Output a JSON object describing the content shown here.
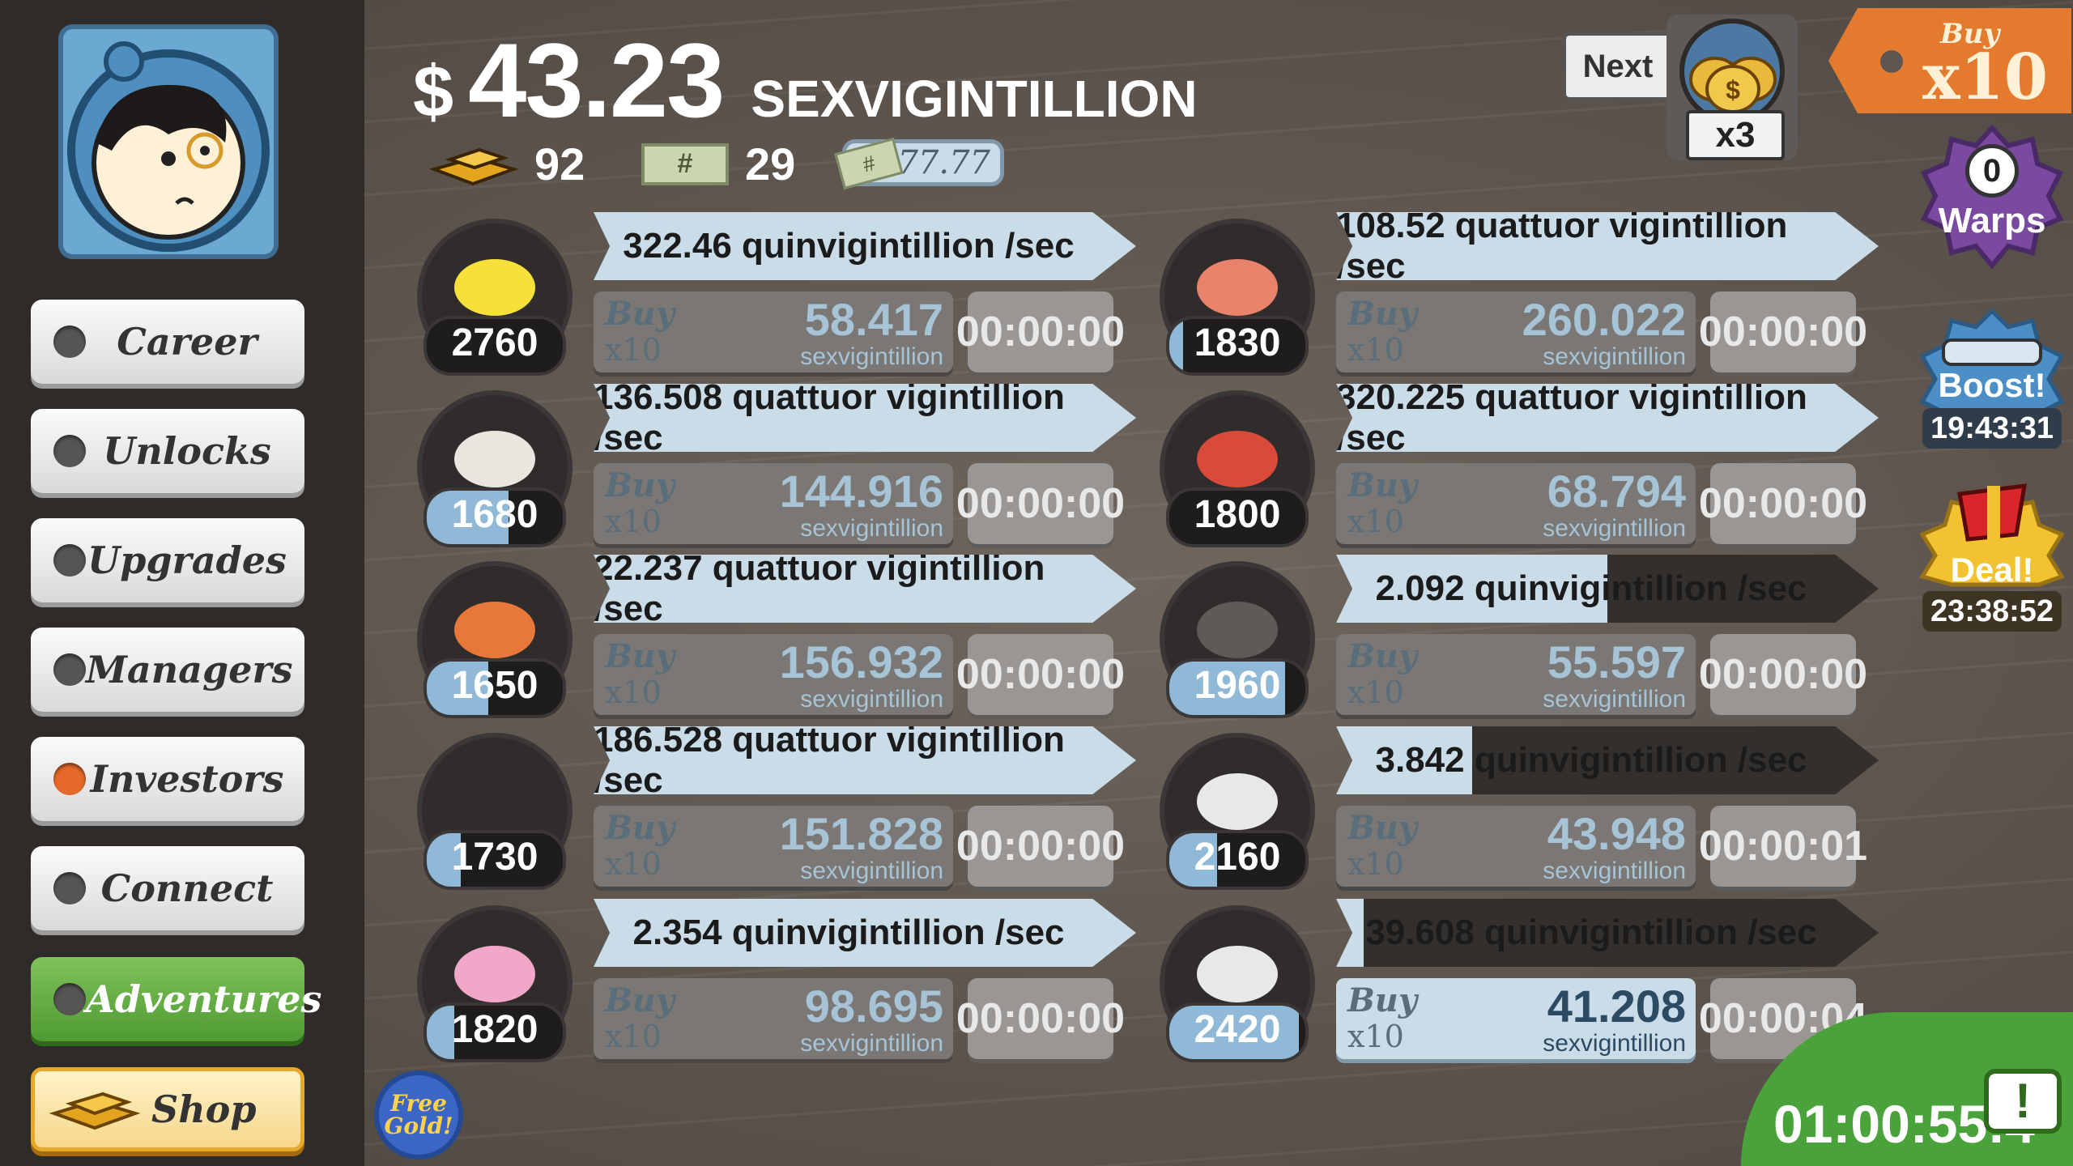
{
  "header": {
    "dollar": "$",
    "amount": "43.23",
    "unit": "SEXVIGINTILLION",
    "gold_count": "92",
    "megabucks_count": "29",
    "megabucks_mult": "x77.77",
    "next_label": "Next",
    "multiplier_label": "x3",
    "buy_mode_top": "Buy",
    "buy_mode_value": "x10"
  },
  "sidebar": {
    "items": [
      {
        "label": "Career",
        "dot": "gray"
      },
      {
        "label": "Unlocks",
        "dot": "gray"
      },
      {
        "label": "Upgrades",
        "dot": "gray"
      },
      {
        "label": "Managers",
        "dot": "gray"
      },
      {
        "label": "Investors",
        "dot": "orange"
      },
      {
        "label": "Connect",
        "dot": "gray"
      },
      {
        "label": "Adventures",
        "dot": "gray"
      }
    ],
    "shop_label": "Shop",
    "free_gold_label": "Free Gold!"
  },
  "businesses": [
    {
      "icon": "lemon-icon",
      "level": "2760",
      "level_fill": 0.0,
      "rate": "322.46 quinvigintillion /sec",
      "rate_fill": 1.0,
      "buy_top": "Buy",
      "buy_bottom": "x10",
      "cost": "58.417",
      "cost_unit": "sexvigintillion",
      "timer": "00:00:00",
      "buy_active": false
    },
    {
      "icon": "newspaper-icon",
      "level": "1680",
      "level_fill": 0.6,
      "rate": "136.508 quattuor vigintillion /sec",
      "rate_fill": 1.0,
      "buy_top": "Buy",
      "buy_bottom": "x10",
      "cost": "144.916",
      "cost_unit": "sexvigintillion",
      "timer": "00:00:00",
      "buy_active": false
    },
    {
      "icon": "car-wash-icon",
      "level": "1650",
      "level_fill": 0.45,
      "rate": "22.237 quattuor vigintillion /sec",
      "rate_fill": 1.0,
      "buy_top": "Buy",
      "buy_bottom": "x10",
      "cost": "156.932",
      "cost_unit": "sexvigintillion",
      "timer": "00:00:00",
      "buy_active": false
    },
    {
      "icon": "pizza-icon",
      "level": "1730",
      "level_fill": 0.25,
      "rate": "186.528 quattuor vigintillion /sec",
      "rate_fill": 1.0,
      "buy_top": "Buy",
      "buy_bottom": "x10",
      "cost": "151.828",
      "cost_unit": "sexvigintillion",
      "timer": "00:00:00",
      "buy_active": false
    },
    {
      "icon": "donut-icon",
      "level": "1820",
      "level_fill": 0.2,
      "rate": "2.354 quinvigintillion /sec",
      "rate_fill": 1.0,
      "buy_top": "Buy",
      "buy_bottom": "x10",
      "cost": "98.695",
      "cost_unit": "sexvigintillion",
      "timer": "00:00:00",
      "buy_active": false
    },
    {
      "icon": "shrimp-icon",
      "level": "1830",
      "level_fill": 0.1,
      "rate": "108.52 quattuor vigintillion /sec",
      "rate_fill": 1.0,
      "buy_top": "Buy",
      "buy_bottom": "x10",
      "cost": "260.022",
      "cost_unit": "sexvigintillion",
      "timer": "00:00:00",
      "buy_active": false
    },
    {
      "icon": "hockey-icon",
      "level": "1800",
      "level_fill": 0.0,
      "rate": "320.225 quattuor vigintillion /sec",
      "rate_fill": 1.0,
      "buy_top": "Buy",
      "buy_bottom": "x10",
      "cost": "68.794",
      "cost_unit": "sexvigintillion",
      "timer": "00:00:00",
      "buy_active": false
    },
    {
      "icon": "movie-camera-icon",
      "level": "1960",
      "level_fill": 0.85,
      "rate": "2.092 quinvigintillion /sec",
      "rate_fill": 0.5,
      "buy_top": "Buy",
      "buy_bottom": "x10",
      "cost": "55.597",
      "cost_unit": "sexvigintillion",
      "timer": "00:00:00",
      "buy_active": false
    },
    {
      "icon": "bank-icon",
      "level": "2160",
      "level_fill": 0.35,
      "rate": "3.842 quinvigintillion /sec",
      "rate_fill": 0.25,
      "buy_top": "Buy",
      "buy_bottom": "x10",
      "cost": "43.948",
      "cost_unit": "sexvigintillion",
      "timer": "00:00:01",
      "buy_active": false
    },
    {
      "icon": "oil-rig-icon",
      "level": "2420",
      "level_fill": 0.95,
      "rate": "39.608 quinvigintillion /sec",
      "rate_fill": 0.05,
      "buy_top": "Buy",
      "buy_bottom": "x10",
      "cost": "41.208",
      "cost_unit": "sexvigintillion",
      "timer": "00:00:04",
      "buy_active": true
    }
  ],
  "right": {
    "warps_count": "0",
    "warps_label": "Warps",
    "boost_label": "Boost!",
    "boost_timer": "19:43:31",
    "deal_label": "Deal!",
    "deal_timer": "23:38:52",
    "event_timer": "01:00:55:4",
    "event_icon": "tv-alert-icon"
  },
  "colors": {
    "accent_blue": "#c9dce8",
    "green": "#4aa33a",
    "orange": "#e47a2d",
    "purple": "#7a4aa0",
    "gold": "#f2c230"
  }
}
